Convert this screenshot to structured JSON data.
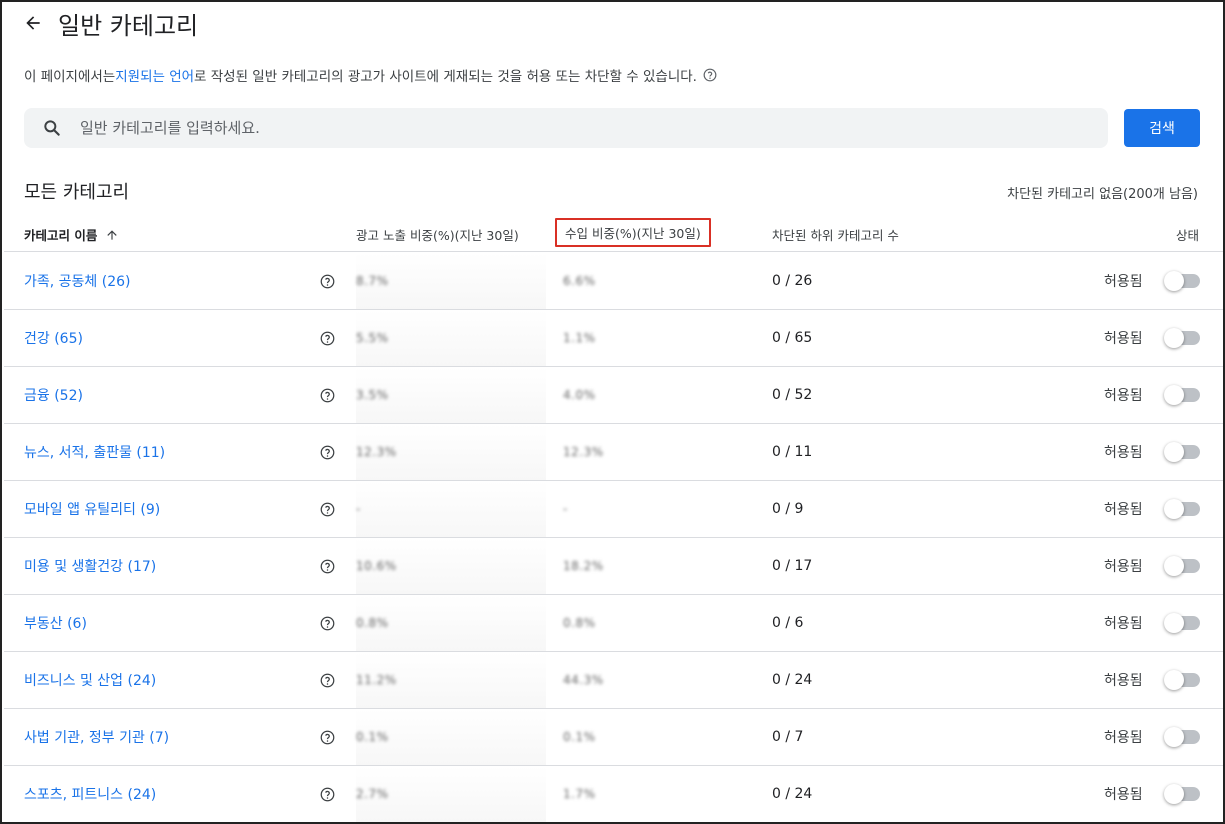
{
  "header": {
    "title": "일반 카테고리"
  },
  "description": {
    "prefix": "이 페이지에서는 ",
    "link": "지원되는 언어",
    "suffix": "로 작성된 일반 카테고리의 광고가 사이트에 게재되는 것을 허용 또는 차단할 수 있습니다."
  },
  "search": {
    "placeholder": "일반 카테고리를 입력하세요.",
    "button_label": "검색"
  },
  "section": {
    "title": "모든 카테고리",
    "blocked_summary": "차단된 카테고리 없음(200개 남음)"
  },
  "table": {
    "headers": {
      "name": "카테고리 이름",
      "impressions": "광고 노출 비중(%)(지난 30일)",
      "revenue": "수입 비중(%)(지난 30일)",
      "blocked_sub": "차단된 하위 카테고리 수",
      "status": "상태"
    },
    "rows": [
      {
        "name": "가족, 공동체 (26)",
        "impressions": "8.7%",
        "revenue": "6.6%",
        "blocked_sub": "0 / 26",
        "status": "허용됨"
      },
      {
        "name": "건강 (65)",
        "impressions": "5.5%",
        "revenue": "1.1%",
        "blocked_sub": "0 / 65",
        "status": "허용됨"
      },
      {
        "name": "금융 (52)",
        "impressions": "3.5%",
        "revenue": "4.0%",
        "blocked_sub": "0 / 52",
        "status": "허용됨"
      },
      {
        "name": "뉴스, 서적, 출판물 (11)",
        "impressions": "12.3%",
        "revenue": "12.3%",
        "blocked_sub": "0 / 11",
        "status": "허용됨"
      },
      {
        "name": "모바일 앱 유틸리티 (9)",
        "impressions": "-",
        "revenue": "-",
        "blocked_sub": "0 / 9",
        "status": "허용됨"
      },
      {
        "name": "미용 및 생활건강 (17)",
        "impressions": "10.6%",
        "revenue": "18.2%",
        "blocked_sub": "0 / 17",
        "status": "허용됨"
      },
      {
        "name": "부동산 (6)",
        "impressions": "0.8%",
        "revenue": "0.8%",
        "blocked_sub": "0 / 6",
        "status": "허용됨"
      },
      {
        "name": "비즈니스 및 산업 (24)",
        "impressions": "11.2%",
        "revenue": "44.3%",
        "blocked_sub": "0 / 24",
        "status": "허용됨"
      },
      {
        "name": "사법 기관, 정부 기관 (7)",
        "impressions": "0.1%",
        "revenue": "0.1%",
        "blocked_sub": "0 / 7",
        "status": "허용됨"
      },
      {
        "name": "스포츠, 피트니스 (24)",
        "impressions": "2.7%",
        "revenue": "1.7%",
        "blocked_sub": "0 / 24",
        "status": "허용됨"
      }
    ]
  },
  "colors": {
    "link": "#1a73e8",
    "primary_button": "#1a73e8",
    "highlight_border": "#d93025",
    "toggle_off": "#bdc1c6"
  },
  "icons": {
    "back": "arrow-back-icon",
    "help": "help-circle-icon",
    "search": "search-icon",
    "sort": "arrow-up-icon"
  }
}
